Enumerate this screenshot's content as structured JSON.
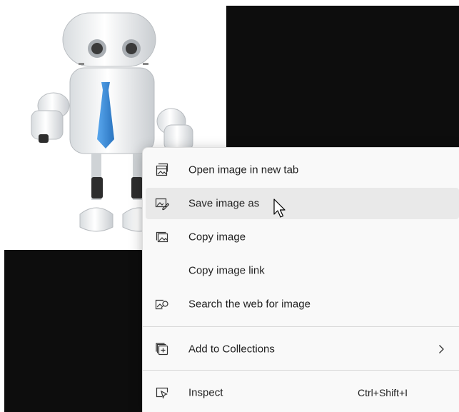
{
  "menu": {
    "items": [
      {
        "label": "Open image in new tab",
        "icon": "open-image-new-tab-icon"
      },
      {
        "label": "Save image as",
        "icon": "save-image-icon",
        "state": "hover"
      },
      {
        "label": "Copy image",
        "icon": "copy-image-icon"
      },
      {
        "label": "Copy image link",
        "icon": null
      },
      {
        "label": "Search the web for image",
        "icon": "visual-search-icon"
      },
      {
        "label": "Add to Collections",
        "icon": "add-to-collections-icon",
        "submenu": true
      },
      {
        "label": "Inspect",
        "icon": "inspect-icon",
        "shortcut": "Ctrl+Shift+I"
      }
    ]
  },
  "colors": {
    "menu_background": "#f9f9f9",
    "hover_background": "#e9e9e9",
    "page_dark": "#0d0d0d",
    "tie_blue": "#3b8fd8"
  }
}
